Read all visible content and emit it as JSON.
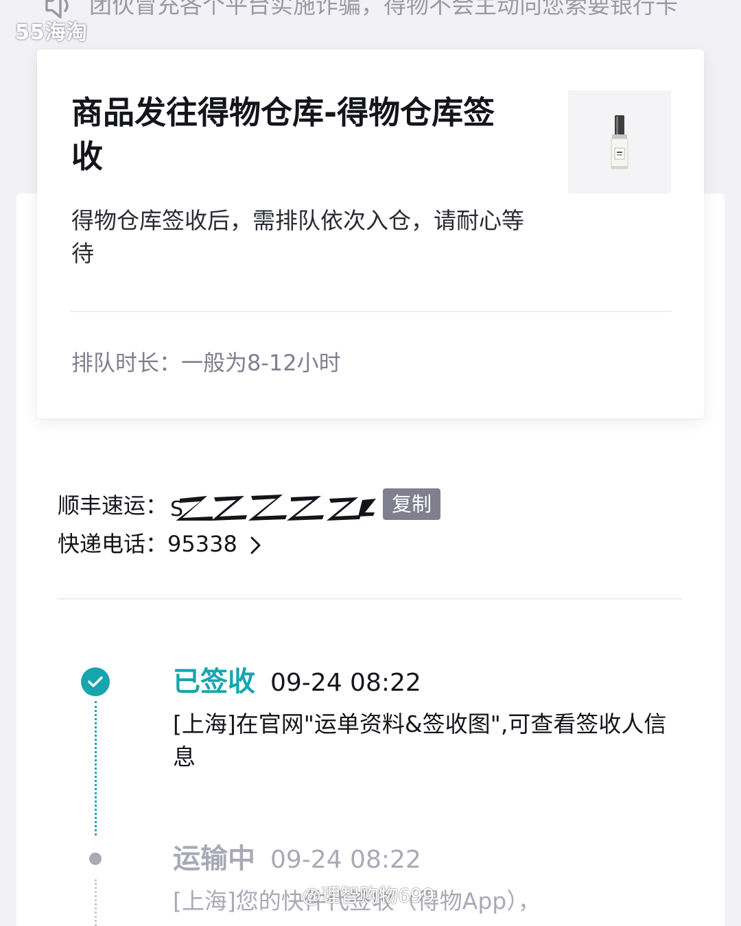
{
  "notice": {
    "text": "团伙冒充各个平台实施诈骗，得物不会主动向您索要银行卡",
    "icon": "speaker-icon"
  },
  "watermark_logo": "55海淘",
  "status_card": {
    "title": "商品发往得物仓库-得物仓库签收",
    "description": "得物仓库签收后，需排队依次入仓，请耐心等待",
    "queue_label": "排队时长：",
    "queue_value": "一般为8-12小时",
    "product_image": "perfume-bottle-thumbnail"
  },
  "courier": {
    "company_label": "顺丰速运：",
    "tracking_prefix": "S",
    "copy_label": "复制",
    "phone_label": "快递电话：",
    "phone_value": "95338"
  },
  "timeline": [
    {
      "status": "已签收",
      "time": "09-24 08:22",
      "description": "[上海]在官网\"运单资料&签收图\",可查看签收人信息",
      "state": "done"
    },
    {
      "status": "运输中",
      "time": "09-24 08:22",
      "description": "[上海]您的快件代签收（得物App），",
      "state": "pending"
    }
  ],
  "watermark_bottom": "@理智购物699",
  "colors": {
    "accent": "#16a5af",
    "muted": "#a9a9b6",
    "copy_button": "#7f7f8e",
    "background": "#f2f2f6"
  }
}
